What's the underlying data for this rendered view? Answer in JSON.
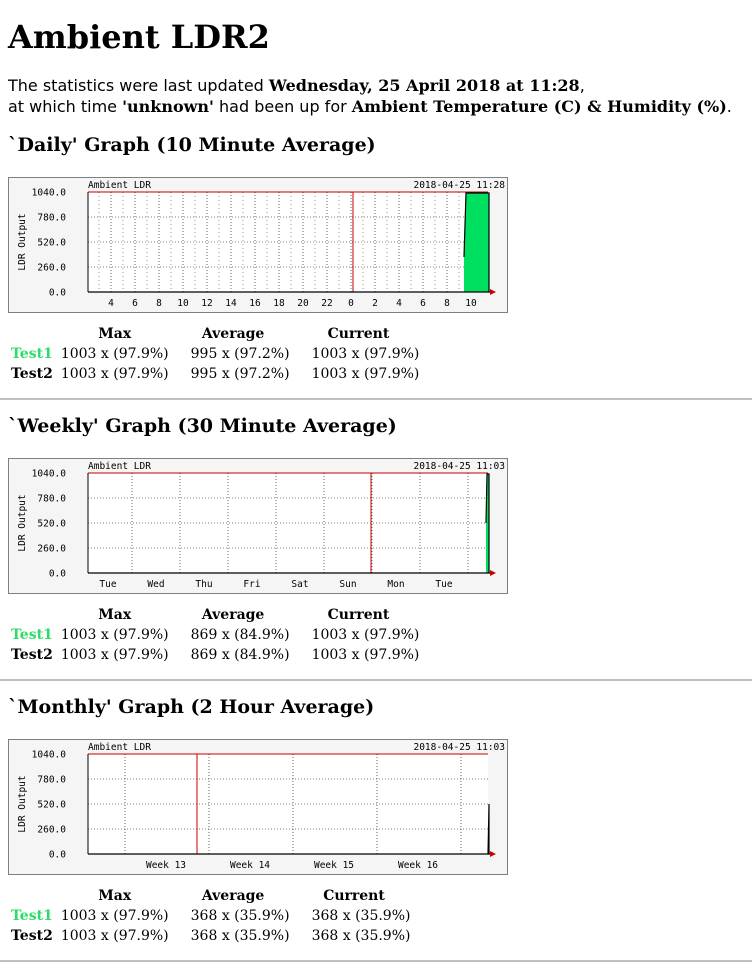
{
  "page_title": "Ambient LDR2",
  "summary": {
    "line1_prefix": "The statistics were last updated ",
    "updated": "Wednesday, 25 April 2018 at 11:28",
    "line1_suffix": ",",
    "line2_prefix": "at which time ",
    "device": "'unknown'",
    "line2_mid": " had been up for ",
    "uptime": "Ambient Temperature (C) & Humidity (%)",
    "line2_suffix": "."
  },
  "colors": {
    "in_fill": "#00e060",
    "out_line": "#000000",
    "vline": "#cc0000",
    "grid": "#000000",
    "bg": "#f5f5f5",
    "test1": "#2bdc66"
  },
  "stats_headers": [
    "Max",
    "Average",
    "Current"
  ],
  "sections": [
    {
      "title": "`Daily' Graph (10 Minute Average)",
      "graph": {
        "label": "Ambient LDR",
        "timestamp": "2018-04-25 11:28",
        "ylabel": "LDR Output",
        "yticks": [
          "1040.0",
          "780.0",
          "520.0",
          "260.0",
          "0.0"
        ],
        "xticks": [
          "4",
          "6",
          "8",
          "10",
          "12",
          "14",
          "16",
          "18",
          "20",
          "22",
          "0",
          "2",
          "4",
          "6",
          "8",
          "10"
        ]
      },
      "rows": [
        {
          "name": "Test1",
          "max": "1003 x (97.9%)",
          "avg": "995 x (97.2%)",
          "cur": "1003 x (97.9%)"
        },
        {
          "name": "Test2",
          "max": "1003 x (97.9%)",
          "avg": "995 x (97.2%)",
          "cur": "1003 x (97.9%)"
        }
      ]
    },
    {
      "title": "`Weekly' Graph (30 Minute Average)",
      "graph": {
        "label": "Ambient LDR",
        "timestamp": "2018-04-25 11:03",
        "ylabel": "LDR Output",
        "yticks": [
          "1040.0",
          "780.0",
          "520.0",
          "260.0",
          "0.0"
        ],
        "xticks": [
          "Tue",
          "Wed",
          "Thu",
          "Fri",
          "Sat",
          "Sun",
          "Mon",
          "Tue"
        ]
      },
      "rows": [
        {
          "name": "Test1",
          "max": "1003 x (97.9%)",
          "avg": "869 x (84.9%)",
          "cur": "1003 x (97.9%)"
        },
        {
          "name": "Test2",
          "max": "1003 x (97.9%)",
          "avg": "869 x (84.9%)",
          "cur": "1003 x (97.9%)"
        }
      ]
    },
    {
      "title": "`Monthly' Graph (2 Hour Average)",
      "graph": {
        "label": "Ambient LDR",
        "timestamp": "2018-04-25 11:03",
        "ylabel": "LDR Output",
        "yticks": [
          "1040.0",
          "780.0",
          "520.0",
          "260.0",
          "0.0"
        ],
        "xticks": [
          "Week 13",
          "Week 14",
          "Week 15",
          "Week 16"
        ]
      },
      "rows": [
        {
          "name": "Test1",
          "max": "1003 x (97.9%)",
          "avg": "368 x (35.9%)",
          "cur": "368 x (35.9%)"
        },
        {
          "name": "Test2",
          "max": "1003 x (97.9%)",
          "avg": "368 x (35.9%)",
          "cur": "368 x (35.9%)"
        }
      ]
    }
  ]
}
